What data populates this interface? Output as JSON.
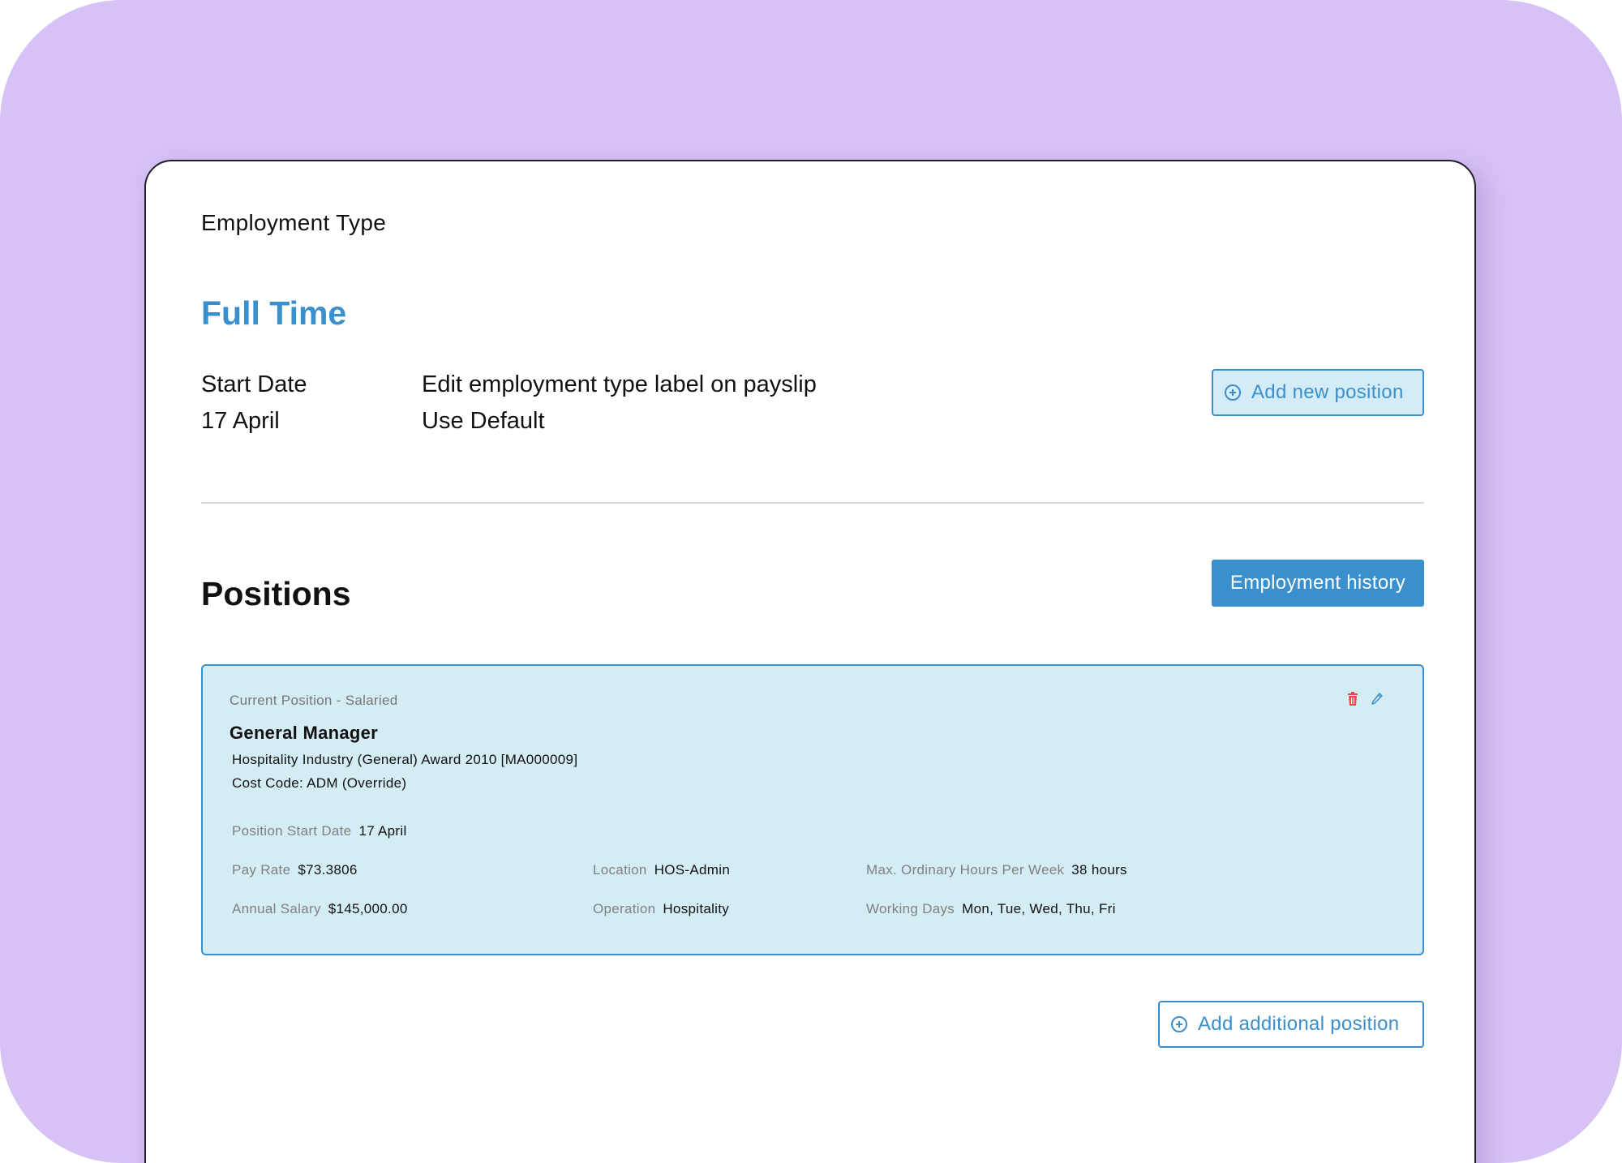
{
  "colors": {
    "accent": "#3a8fcd",
    "accent_light": "#d4ecf4",
    "backdrop": "#d6c2f5",
    "delete": "#e5484d"
  },
  "employment": {
    "section_label": "Employment Type",
    "type": "Full Time",
    "start_date_label": "Start Date",
    "start_date_value": "17 April",
    "payslip_label_title": "Edit employment type label on payslip",
    "payslip_label_value": "Use Default",
    "add_new_position_label": "Add new position"
  },
  "positions": {
    "title": "Positions",
    "employment_history_label": "Employment history",
    "add_additional_position_label": "Add additional position",
    "current": {
      "kicker": "Current Position - Salaried",
      "title": "General Manager",
      "award": "Hospitality Industry (General) Award 2010 [MA000009]",
      "cost_code": "Cost Code: ADM (Override)",
      "start_date_label": "Position Start Date",
      "start_date_value": "17 April",
      "pay_rate_label": "Pay Rate",
      "pay_rate_value": "$73.3806",
      "annual_salary_label": "Annual Salary",
      "annual_salary_value": "$145,000.00",
      "location_label": "Location",
      "location_value": "HOS-Admin",
      "operation_label": "Operation",
      "operation_value": "Hospitality",
      "max_hours_label": "Max. Ordinary Hours Per Week",
      "max_hours_value": "38 hours",
      "working_days_label": "Working Days",
      "working_days_value": "Mon, Tue, Wed, Thu, Fri",
      "icons": [
        "trash-icon",
        "pencil-icon"
      ]
    }
  }
}
